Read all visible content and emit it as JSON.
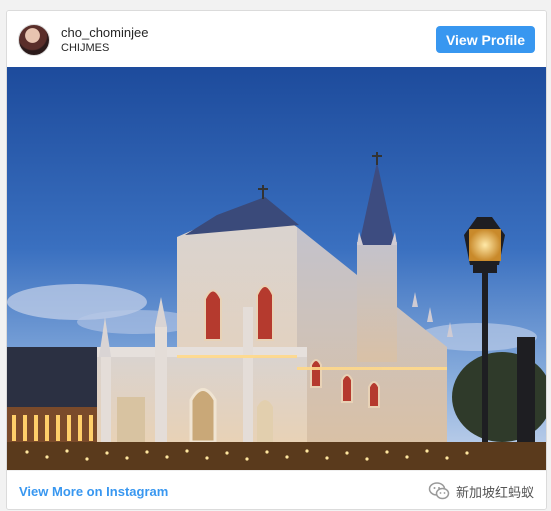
{
  "post": {
    "username": "cho_chominjee",
    "location": "CHIJMES",
    "view_profile_label": "View Profile",
    "image_alt": "CHIJMES chapel at dusk"
  },
  "footer": {
    "view_more_label": "View More on Instagram",
    "watermark_text": "新加坡红蚂蚁"
  },
  "colors": {
    "accent": "#3897f0",
    "sky_top": "#1f4fa0",
    "sky_bottom": "#a9c4e6"
  },
  "icons": {
    "watermark": "wechat-icon",
    "avatar": "user-avatar"
  }
}
